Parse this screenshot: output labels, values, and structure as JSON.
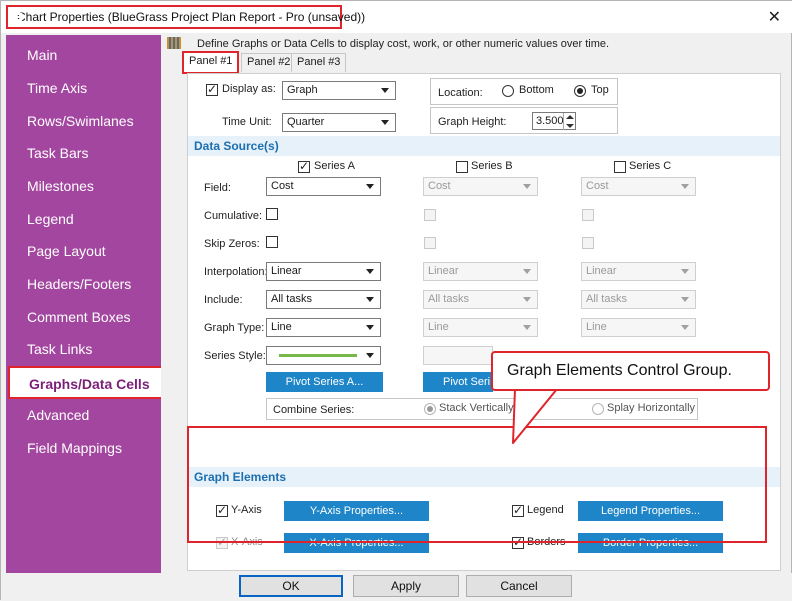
{
  "window": {
    "title": "Chart Properties (BlueGrass Project Plan Report - Pro (unsaved))",
    "close": "✕"
  },
  "sidebar": {
    "items": [
      {
        "label": "Main"
      },
      {
        "label": "Time Axis"
      },
      {
        "label": "Rows/Swimlanes"
      },
      {
        "label": "Task Bars"
      },
      {
        "label": "Milestones"
      },
      {
        "label": "Legend"
      },
      {
        "label": "Page Layout"
      },
      {
        "label": "Headers/Footers"
      },
      {
        "label": "Comment Boxes"
      },
      {
        "label": "Task Links"
      },
      {
        "label": "Graphs/Data Cells",
        "active": true
      },
      {
        "label": "Advanced"
      },
      {
        "label": "Field Mappings"
      }
    ]
  },
  "main": {
    "description": "Define Graphs or Data Cells to display cost, work, or other numeric values over time.",
    "tabs": [
      "Panel #1",
      "Panel #2",
      "Panel #3"
    ]
  },
  "settings": {
    "display_as_label": "Display as:",
    "display_as_value": "Graph",
    "display_as_checked": true,
    "location_label": "Location:",
    "location_bottom": "Bottom",
    "location_top": "Top",
    "location_selected": "Top",
    "time_unit_label": "Time Unit:",
    "time_unit_value": "Quarter",
    "graph_height_label": "Graph Height:",
    "graph_height_value": "3.500"
  },
  "data_source": {
    "heading": "Data Source(s)",
    "row_labels": {
      "field": "Field:",
      "cumulative": "Cumulative:",
      "skip_zeros": "Skip Zeros:",
      "interpolation": "Interpolation:",
      "include": "Include:",
      "graph_type": "Graph Type:",
      "series_style": "Series Style:"
    },
    "series": [
      {
        "name": "Series A",
        "checked": true,
        "field": "Cost",
        "interpolation": "Linear",
        "include": "All tasks",
        "graph_type": "Line",
        "pivot": "Pivot Series A...",
        "style_color": "#77b849"
      },
      {
        "name": "Series B",
        "checked": false,
        "field": "Cost",
        "interpolation": "Linear",
        "include": "All tasks",
        "graph_type": "Line",
        "pivot": "Pivot Seri"
      },
      {
        "name": "Series C",
        "checked": false,
        "field": "Cost",
        "interpolation": "Linear",
        "include": "All tasks",
        "graph_type": "Line"
      }
    ],
    "combine_label": "Combine Series:",
    "stack_vertically": "Stack Vertically",
    "splay_horizontally": "Splay Horizontally"
  },
  "graph_elements": {
    "heading": "Graph Elements",
    "y_axis_label": "Y-Axis",
    "y_axis_button": "Y-Axis Properties...",
    "x_axis_label": "X-Axis",
    "x_axis_button": "X-Axis Properties...",
    "legend_label": "Legend",
    "legend_button": "Legend Properties...",
    "borders_label": "Borders",
    "borders_button": "Border Properties..."
  },
  "callout": {
    "text": "Graph Elements Control Group."
  },
  "footer": {
    "ok": "OK",
    "apply": "Apply",
    "cancel": "Cancel"
  },
  "colors": {
    "sidebar": "#a3469f",
    "accent_blue": "#1e86c8",
    "annotation_red": "#e0242b"
  }
}
